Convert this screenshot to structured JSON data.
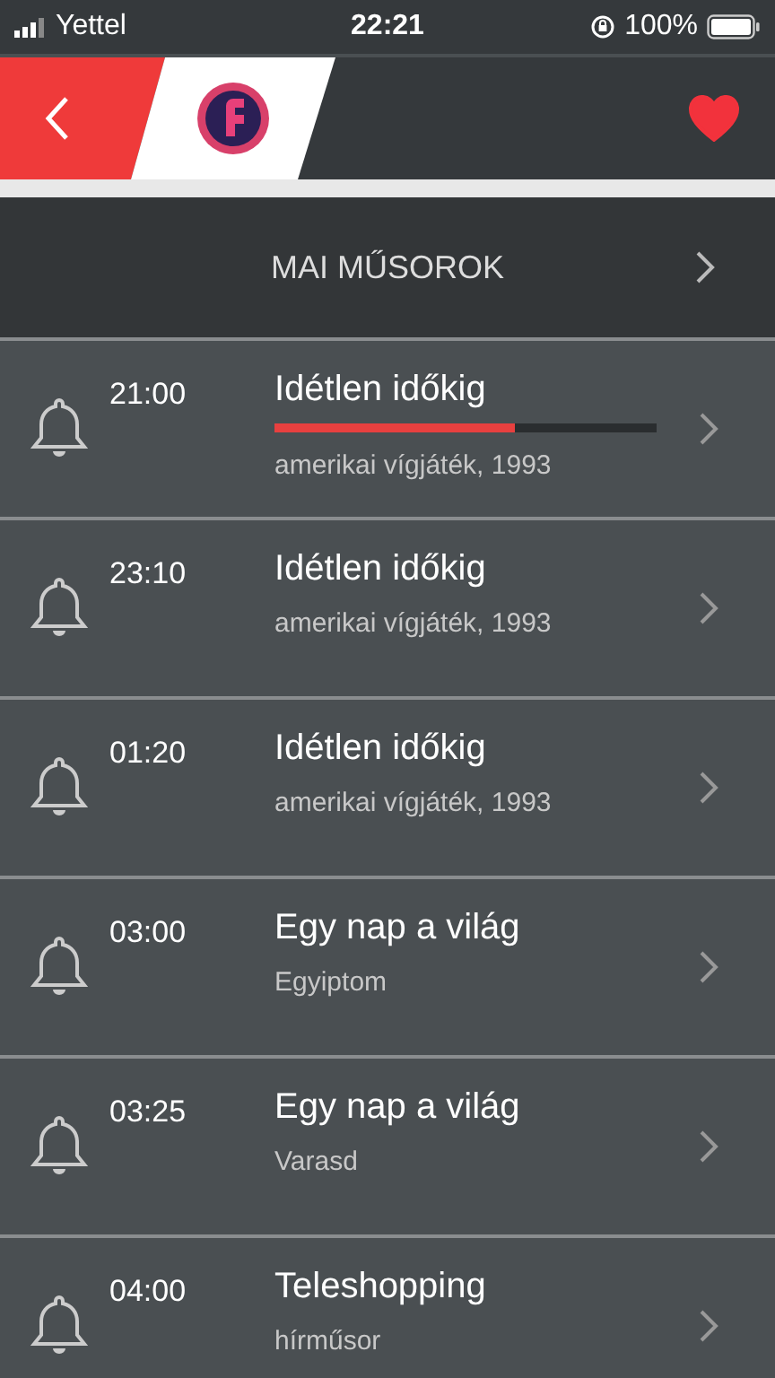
{
  "status_bar": {
    "carrier": "Yettel",
    "time": "22:21",
    "battery": "100%"
  },
  "header": {
    "favorite": true
  },
  "section": {
    "title": "MAI MŰSOROK"
  },
  "programs": [
    {
      "time": "21:00",
      "title": "Idétlen időkig",
      "subtitle": "amerikai vígjáték, 1993",
      "level": 0.63
    },
    {
      "time": "23:10",
      "title": "Idétlen időkig",
      "subtitle": "amerikai vígjáték, 1993"
    },
    {
      "time": "01:20",
      "title": "Idétlen időkig",
      "subtitle": "amerikai vígjáték, 1993"
    },
    {
      "time": "03:00",
      "title": "Egy nap a világ",
      "subtitle": "Egyiptom"
    },
    {
      "time": "03:25",
      "title": "Egy nap a világ",
      "subtitle": "Varasd"
    },
    {
      "time": "04:00",
      "title": "Teleshopping",
      "subtitle": "hírműsor"
    }
  ]
}
